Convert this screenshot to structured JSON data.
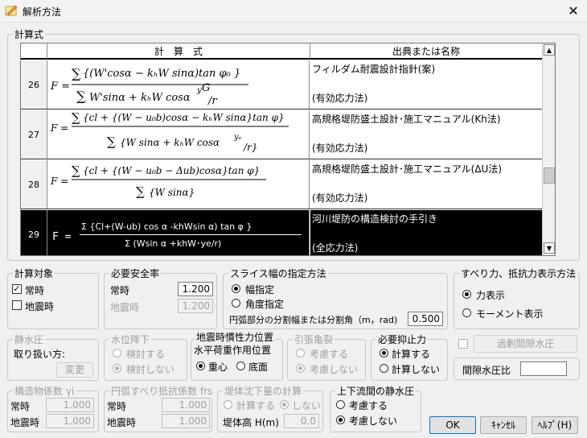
{
  "window": {
    "title": "解析方法",
    "close_glyph": "✕"
  },
  "formula_group": {
    "label": "計算式",
    "col_formula": "計　算　式",
    "col_source": "出典または名称",
    "rows": [
      {
        "num": "26",
        "src1": "フィルダム耐震設計指針(案)",
        "src2": "(有効応力法)"
      },
      {
        "num": "27",
        "src1": "高規格堤防盛土設計･施工マニュアル(Kh法)",
        "src2": "(有効応力法)"
      },
      {
        "num": "28",
        "src1": "高規格堤防盛土設計･施工マニュアル(ΔU法)",
        "src2": "(有効応力法)"
      },
      {
        "num": "29",
        "src1": "河川堤防の構造検討の手引き",
        "src2": "(全応力法)"
      }
    ],
    "formula29_num": "Σ {Cl+(W-ub) cos α -khWsin α) tan φ }",
    "formula29_den": "Σ (Wsin α +khW･ye/r)"
  },
  "target": {
    "label": "計算対象",
    "normal": "常時",
    "quake": "地震時",
    "normal_checked": true,
    "quake_checked": false
  },
  "safety": {
    "label": "必要安全率",
    "normal": "常時",
    "normal_value": "1.200",
    "quake": "地震時",
    "quake_value": "1.200"
  },
  "slice": {
    "label": "スライス幅の指定方法",
    "opt1": "幅指定",
    "opt2": "角度指定",
    "arc_label": "円弧部分の分割幅または分割角（m，rad)",
    "arc_value": "0.500"
  },
  "display": {
    "label": "すべり力、抵抗力表示方法",
    "opt1": "力表示",
    "opt2": "モーメント表示"
  },
  "static_water": {
    "label": "静水圧",
    "handle": "取り扱い方:",
    "change_btn": "変更"
  },
  "water_drop": {
    "label": "水位降下",
    "opt1": "検討する",
    "opt2": "検討しない"
  },
  "inertia": {
    "label1": "地震時慣性力位置",
    "label2": "水平荷重作用位置",
    "opt1": "重心",
    "opt2": "底面"
  },
  "tension_crack": {
    "label": "引張亀裂",
    "opt1": "考慮する",
    "opt2": "考慮しない"
  },
  "restraint": {
    "label": "必要抑止力",
    "opt1": "計算する",
    "opt2": "計算しない"
  },
  "excess_pore": {
    "btn": "過剰間隙水圧",
    "ratio_label": "間隙水圧比",
    "ratio_value": ""
  },
  "seismic_coef": {
    "label": "構造物係数 γi",
    "normal": "常時",
    "normal_value": "1.000",
    "quake": "地震時",
    "quake_value": "1.000"
  },
  "arc_resist": {
    "label": "円弧すべり抵抗係数 frs",
    "normal": "常時",
    "normal_value": "1.000",
    "quake": "地震時",
    "quake_value": "1.000"
  },
  "settlement": {
    "label": "堤体沈下量の計算",
    "opt1": "計算する",
    "opt2": "しない",
    "height_label": "堤体高 H(m)",
    "height_value": "0.0"
  },
  "updown": {
    "label": "上下流間の静水圧",
    "opt1": "考慮する",
    "opt2": "考慮しない"
  },
  "buttons": {
    "ok": "OK",
    "cancel": "ｷｬﾝｾﾙ",
    "help": "ﾍﾙﾌﾟ(H)"
  }
}
